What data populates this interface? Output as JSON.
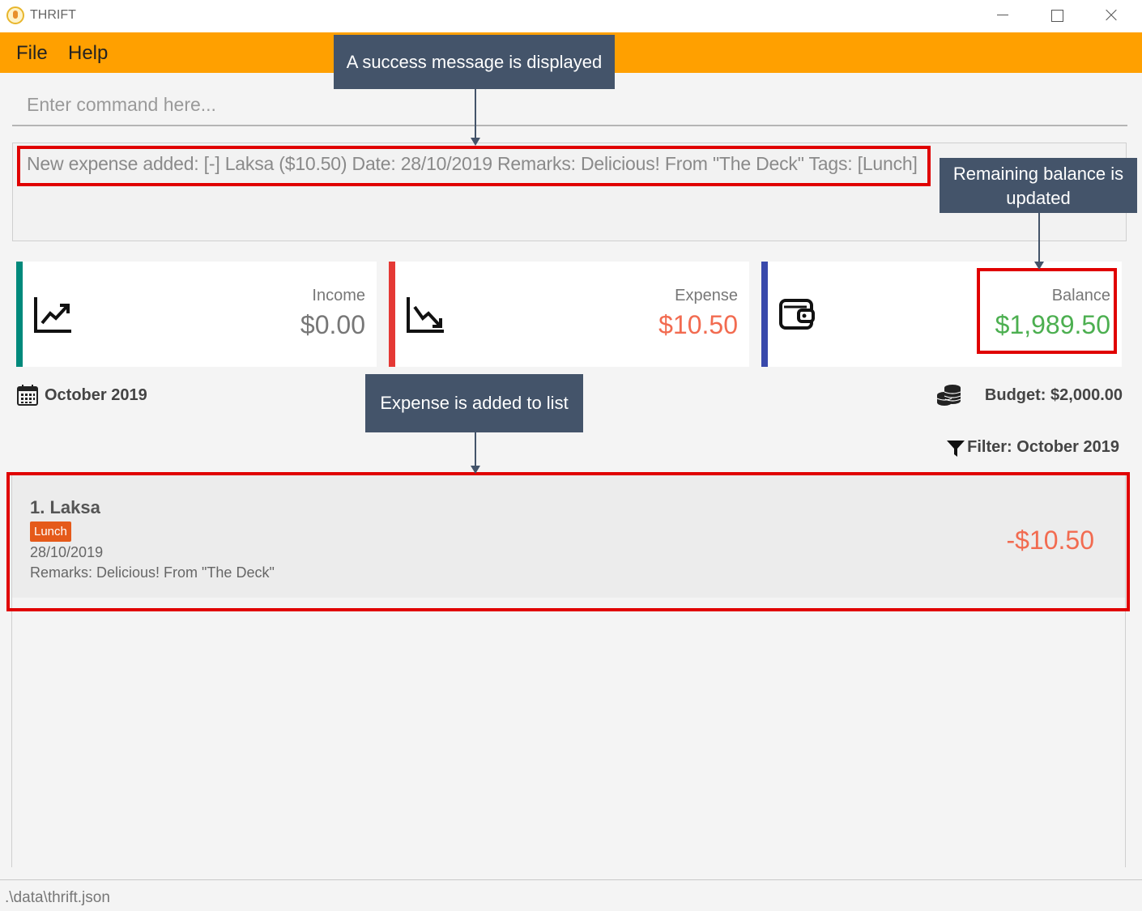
{
  "window": {
    "title": "THRIFT"
  },
  "menu": {
    "file": "File",
    "help": "Help"
  },
  "command": {
    "placeholder": "Enter command here..."
  },
  "result": {
    "message": "New expense added: [-] Laksa ($10.50) Date: 28/10/2019 Remarks: Delicious! From \"The Deck\" Tags: [Lunch]"
  },
  "summary": {
    "income": {
      "label": "Income",
      "value": "$0.00",
      "color": "#777777"
    },
    "expense": {
      "label": "Expense",
      "value": "$10.50",
      "color": "#f26b50"
    },
    "balance": {
      "label": "Balance",
      "value": "$1,989.50",
      "color": "#4caf50"
    }
  },
  "period": {
    "month": "October 2019"
  },
  "budget": {
    "label": "Budget: $2,000.00"
  },
  "filter": {
    "label": "Filter: October 2019"
  },
  "transactions": [
    {
      "name": "1.  Laksa",
      "tag": "Lunch",
      "date": "28/10/2019",
      "remarks": "Remarks: Delicious! From \"The Deck\"",
      "amount": "-$10.50"
    }
  ],
  "status": {
    "path": ".\\data\\thrift.json"
  },
  "annotations": {
    "success": "A success message is displayed",
    "balance": "Remaining balance is updated",
    "list": "Expense is added to list"
  }
}
